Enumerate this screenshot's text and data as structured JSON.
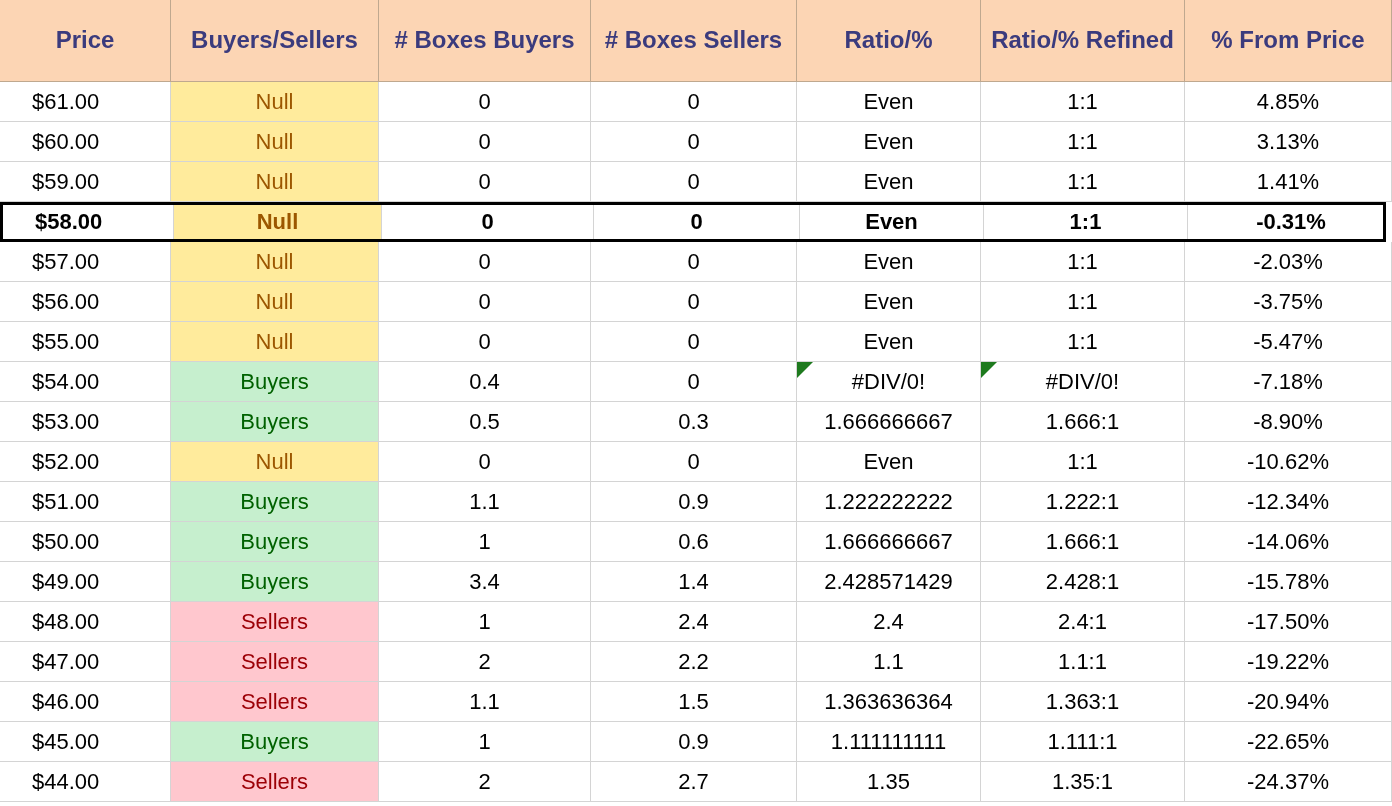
{
  "table": {
    "columns": [
      "Price",
      "Buyers/Sellers",
      "# Boxes Buyers",
      "# Boxes Sellers",
      "Ratio/%",
      "Ratio/% Refined",
      "% From Price"
    ],
    "rows": [
      {
        "price": "$61.00",
        "side": "Null",
        "kind": "null",
        "buyers": "0",
        "sellers": "0",
        "ratio": "Even",
        "refined": "1:1",
        "from_price": "4.85%",
        "current": false,
        "error_flag": false
      },
      {
        "price": "$60.00",
        "side": "Null",
        "kind": "null",
        "buyers": "0",
        "sellers": "0",
        "ratio": "Even",
        "refined": "1:1",
        "from_price": "3.13%",
        "current": false,
        "error_flag": false
      },
      {
        "price": "$59.00",
        "side": "Null",
        "kind": "null",
        "buyers": "0",
        "sellers": "0",
        "ratio": "Even",
        "refined": "1:1",
        "from_price": "1.41%",
        "current": false,
        "error_flag": false
      },
      {
        "price": "$58.00",
        "side": "Null",
        "kind": "null",
        "buyers": "0",
        "sellers": "0",
        "ratio": "Even",
        "refined": "1:1",
        "from_price": "-0.31%",
        "current": true,
        "error_flag": false
      },
      {
        "price": "$57.00",
        "side": "Null",
        "kind": "null",
        "buyers": "0",
        "sellers": "0",
        "ratio": "Even",
        "refined": "1:1",
        "from_price": "-2.03%",
        "current": false,
        "error_flag": false
      },
      {
        "price": "$56.00",
        "side": "Null",
        "kind": "null",
        "buyers": "0",
        "sellers": "0",
        "ratio": "Even",
        "refined": "1:1",
        "from_price": "-3.75%",
        "current": false,
        "error_flag": false
      },
      {
        "price": "$55.00",
        "side": "Null",
        "kind": "null",
        "buyers": "0",
        "sellers": "0",
        "ratio": "Even",
        "refined": "1:1",
        "from_price": "-5.47%",
        "current": false,
        "error_flag": false
      },
      {
        "price": "$54.00",
        "side": "Buyers",
        "kind": "buyers",
        "buyers": "0.4",
        "sellers": "0",
        "ratio": "#DIV/0!",
        "refined": "#DIV/0!",
        "from_price": "-7.18%",
        "current": false,
        "error_flag": true
      },
      {
        "price": "$53.00",
        "side": "Buyers",
        "kind": "buyers",
        "buyers": "0.5",
        "sellers": "0.3",
        "ratio": "1.666666667",
        "refined": "1.666:1",
        "from_price": "-8.90%",
        "current": false,
        "error_flag": false
      },
      {
        "price": "$52.00",
        "side": "Null",
        "kind": "null",
        "buyers": "0",
        "sellers": "0",
        "ratio": "Even",
        "refined": "1:1",
        "from_price": "-10.62%",
        "current": false,
        "error_flag": false
      },
      {
        "price": "$51.00",
        "side": "Buyers",
        "kind": "buyers",
        "buyers": "1.1",
        "sellers": "0.9",
        "ratio": "1.222222222",
        "refined": "1.222:1",
        "from_price": "-12.34%",
        "current": false,
        "error_flag": false
      },
      {
        "price": "$50.00",
        "side": "Buyers",
        "kind": "buyers",
        "buyers": "1",
        "sellers": "0.6",
        "ratio": "1.666666667",
        "refined": "1.666:1",
        "from_price": "-14.06%",
        "current": false,
        "error_flag": false
      },
      {
        "price": "$49.00",
        "side": "Buyers",
        "kind": "buyers",
        "buyers": "3.4",
        "sellers": "1.4",
        "ratio": "2.428571429",
        "refined": "2.428:1",
        "from_price": "-15.78%",
        "current": false,
        "error_flag": false
      },
      {
        "price": "$48.00",
        "side": "Sellers",
        "kind": "sellers",
        "buyers": "1",
        "sellers": "2.4",
        "ratio": "2.4",
        "refined": "2.4:1",
        "from_price": "-17.50%",
        "current": false,
        "error_flag": false
      },
      {
        "price": "$47.00",
        "side": "Sellers",
        "kind": "sellers",
        "buyers": "2",
        "sellers": "2.2",
        "ratio": "1.1",
        "refined": "1.1:1",
        "from_price": "-19.22%",
        "current": false,
        "error_flag": false
      },
      {
        "price": "$46.00",
        "side": "Sellers",
        "kind": "sellers",
        "buyers": "1.1",
        "sellers": "1.5",
        "ratio": "1.363636364",
        "refined": "1.363:1",
        "from_price": "-20.94%",
        "current": false,
        "error_flag": false
      },
      {
        "price": "$45.00",
        "side": "Buyers",
        "kind": "buyers",
        "buyers": "1",
        "sellers": "0.9",
        "ratio": "1.111111111",
        "refined": "1.111:1",
        "from_price": "-22.65%",
        "current": false,
        "error_flag": false
      },
      {
        "price": "$44.00",
        "side": "Sellers",
        "kind": "sellers",
        "buyers": "2",
        "sellers": "2.7",
        "ratio": "1.35",
        "refined": "1.35:1",
        "from_price": "-24.37%",
        "current": false,
        "error_flag": false
      }
    ]
  }
}
